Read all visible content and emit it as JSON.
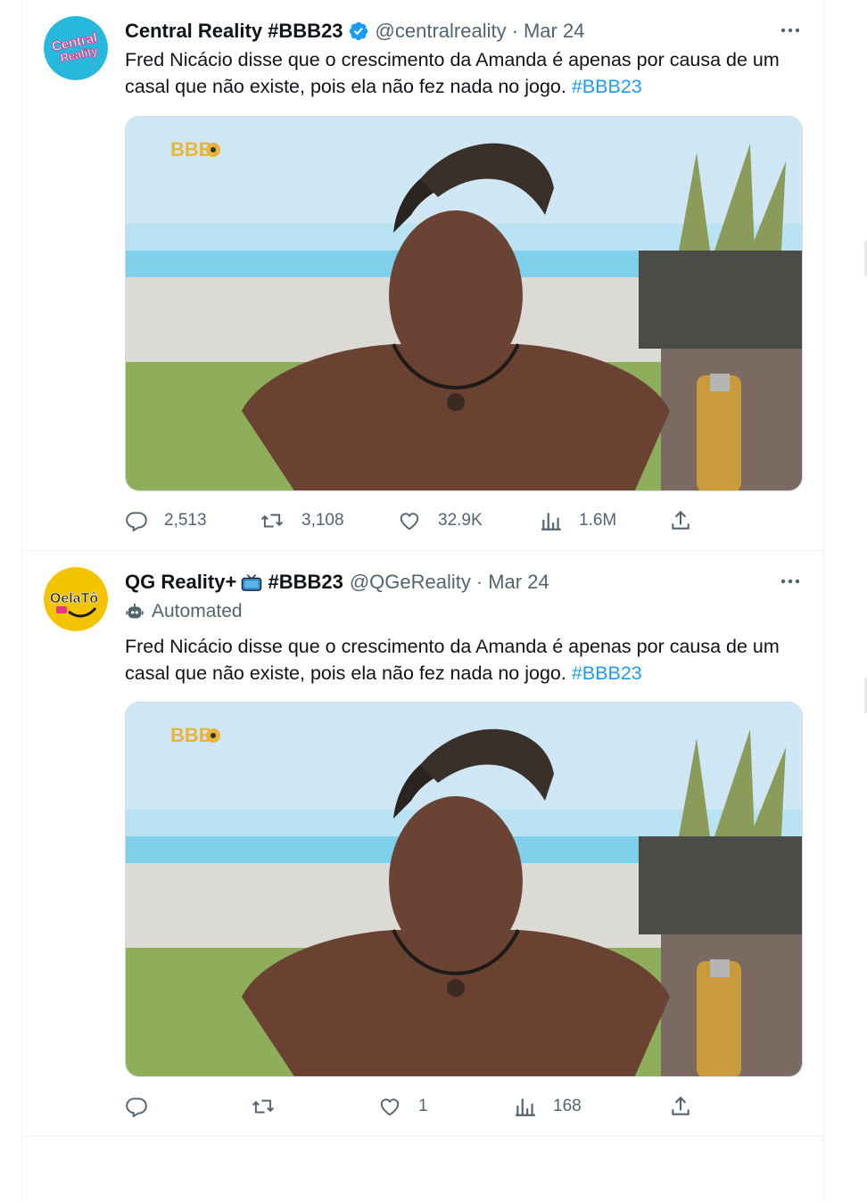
{
  "tweets": [
    {
      "display_name": "Central Reality #BBB23",
      "verified": true,
      "handle": "@centralreality",
      "separator": "·",
      "date": "Mar 24",
      "avatar": {
        "text_line1": "Central",
        "text_line2": "Reality",
        "bg": "#1fb5d9"
      },
      "text": "Fred Nicácio disse que o crescimento da Amanda é apenas por causa de um casal que não existe, pois ela não fez nada no jogo. ",
      "hashtag": "#BBB23",
      "media_logo": "BBB",
      "stats": {
        "replies": "2,513",
        "reposts": "3,108",
        "likes": "32.9K",
        "views": "1.6M"
      }
    },
    {
      "display_name": "QG Reality+",
      "name_emoji": "tv-icon",
      "display_name_suffix": " #BBB23",
      "handle": "@QGeReality",
      "separator": "·",
      "date": "Mar 24",
      "automated_label": "Automated",
      "avatar": {
        "text_line1": "OelaTô",
        "bg": "#f5c400"
      },
      "text": "Fred Nicácio disse que o crescimento da Amanda é apenas por causa de um casal que não existe, pois ela não fez nada no jogo. ",
      "hashtag": "#BBB23",
      "media_logo": "BBB",
      "stats": {
        "replies": "",
        "reposts": "",
        "likes": "1",
        "views": "168"
      }
    }
  ],
  "colors": {
    "link": "#1d9bf0",
    "muted": "#536471",
    "text": "#0f1419",
    "border": "#eff3f4"
  }
}
